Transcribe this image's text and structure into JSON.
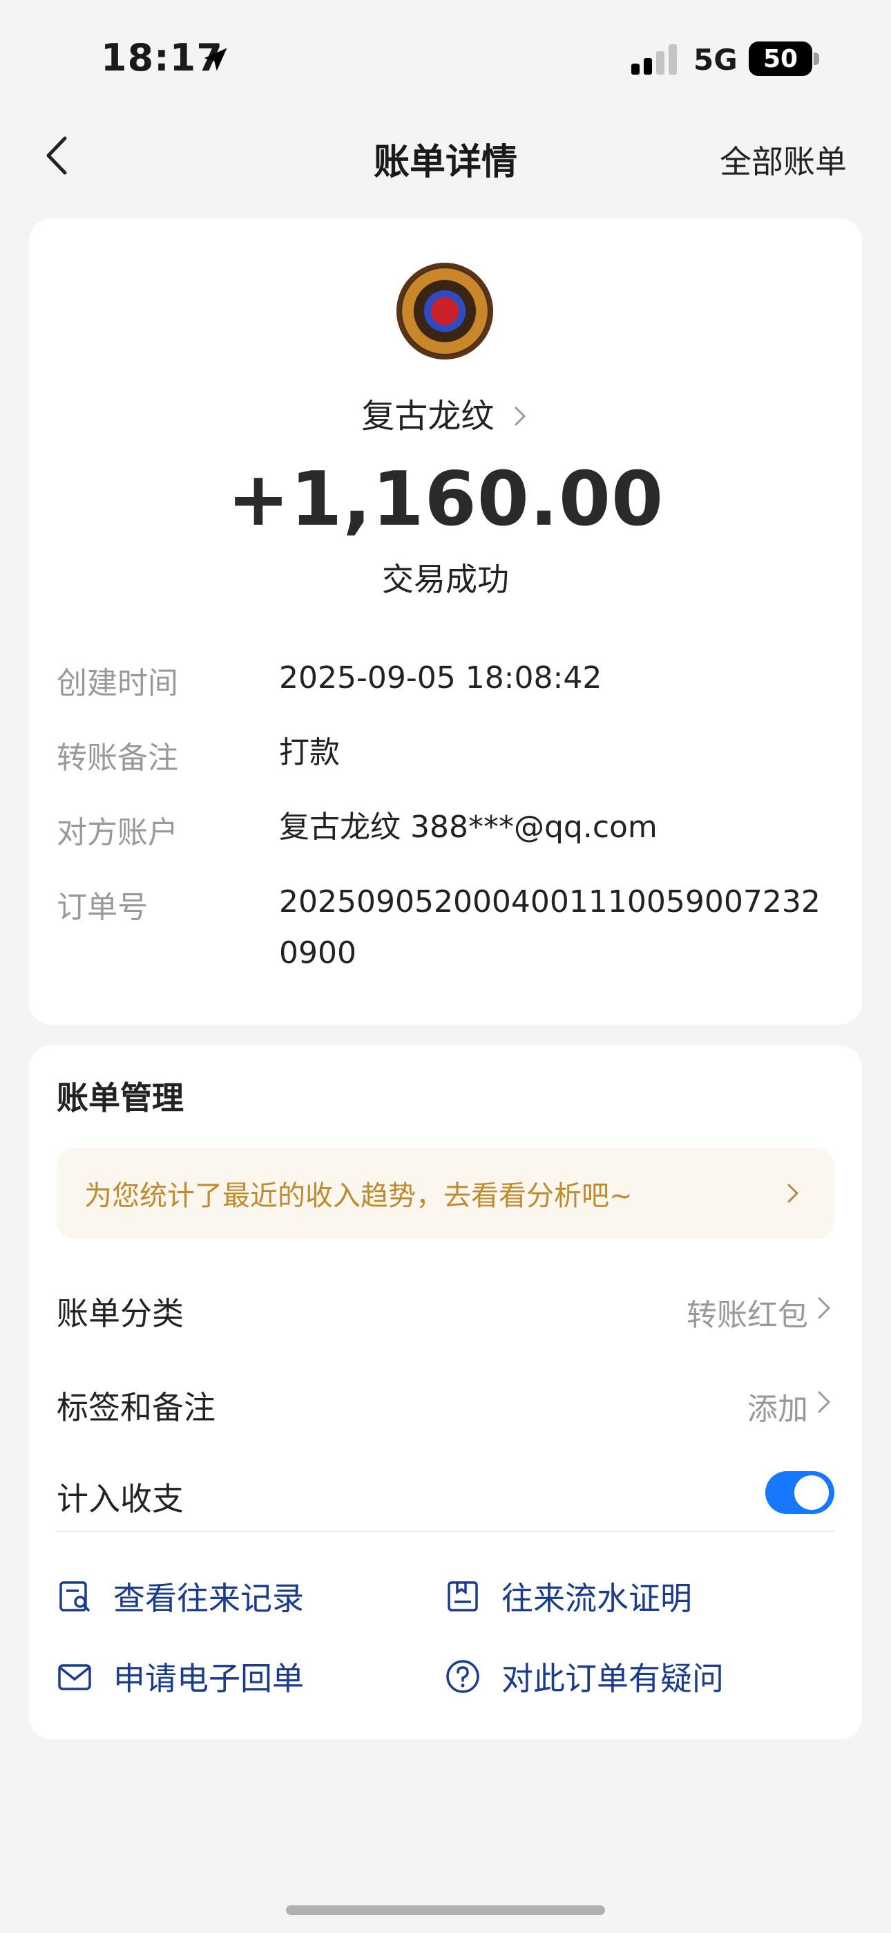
{
  "status_bar": {
    "time": "18:17",
    "network": "5G",
    "battery": "50"
  },
  "nav": {
    "title": "账单详情",
    "all_bills": "全部账单"
  },
  "summary": {
    "merchant": "复古龙纹",
    "amount": "+1,160.00",
    "status": "交易成功"
  },
  "details": [
    {
      "label": "创建时间",
      "value": "2025-09-05 18:08:42"
    },
    {
      "label": "转账备注",
      "value": "打款"
    },
    {
      "label": "对方账户",
      "value": "复古龙纹 388***@qq.com"
    },
    {
      "label": "订单号",
      "value": "20250905200040011100590072320900"
    }
  ],
  "management": {
    "title": "账单管理",
    "banner": "为您统计了最近的收入趋势，去看看分析吧~",
    "category": {
      "label": "账单分类",
      "value": "转账红包"
    },
    "tags": {
      "label": "标签和备注",
      "value": "添加"
    },
    "count_in": {
      "label": "计入收支",
      "enabled": true
    }
  },
  "actions": [
    {
      "label": "查看往来记录",
      "icon": "search-record-icon"
    },
    {
      "label": "往来流水证明",
      "icon": "document-icon"
    },
    {
      "label": "申请电子回单",
      "icon": "mail-icon"
    },
    {
      "label": "对此订单有疑问",
      "icon": "question-icon"
    }
  ],
  "colors": {
    "accent": "#1677ff",
    "link": "#1b3b8c",
    "banner_text": "#c08a2e"
  }
}
